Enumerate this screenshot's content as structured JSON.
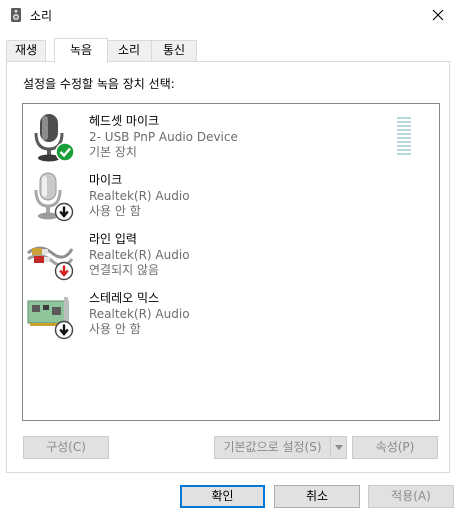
{
  "window": {
    "title": "소리"
  },
  "tabs": [
    {
      "label": "재생",
      "active": false
    },
    {
      "label": "녹음",
      "active": true
    },
    {
      "label": "소리",
      "active": false
    },
    {
      "label": "통신",
      "active": false
    }
  ],
  "panel": {
    "instruction": "설정을 수정할 녹음 장치 선택:"
  },
  "devices": [
    {
      "name": "헤드셋 마이크",
      "desc": "2- USB PnP Audio Device",
      "status": "기본 장치",
      "icon": "headset-mic-icon",
      "badge": "default-check-icon"
    },
    {
      "name": "마이크",
      "desc": "Realtek(R) Audio",
      "status": "사용 안 함",
      "icon": "microphone-icon",
      "badge": "disabled-arrow-icon"
    },
    {
      "name": "라인 입력",
      "desc": "Realtek(R) Audio",
      "status": "연결되지 않음",
      "icon": "line-in-cable-icon",
      "badge": "unplugged-arrow-icon"
    },
    {
      "name": "스테레오 믹스",
      "desc": "Realtek(R) Audio",
      "status": "사용 안 함",
      "icon": "sound-card-icon",
      "badge": "disabled-arrow-icon"
    }
  ],
  "panel_buttons": {
    "configure": "구성(C)",
    "set_default": "기본값으로 설정(S)",
    "properties": "속성(P)"
  },
  "dialog_buttons": {
    "ok": "확인",
    "cancel": "취소",
    "apply": "적용(A)"
  },
  "colors": {
    "accent": "#0078d7",
    "check": "#1a9e3a",
    "unplugged": "#d21f1f"
  }
}
